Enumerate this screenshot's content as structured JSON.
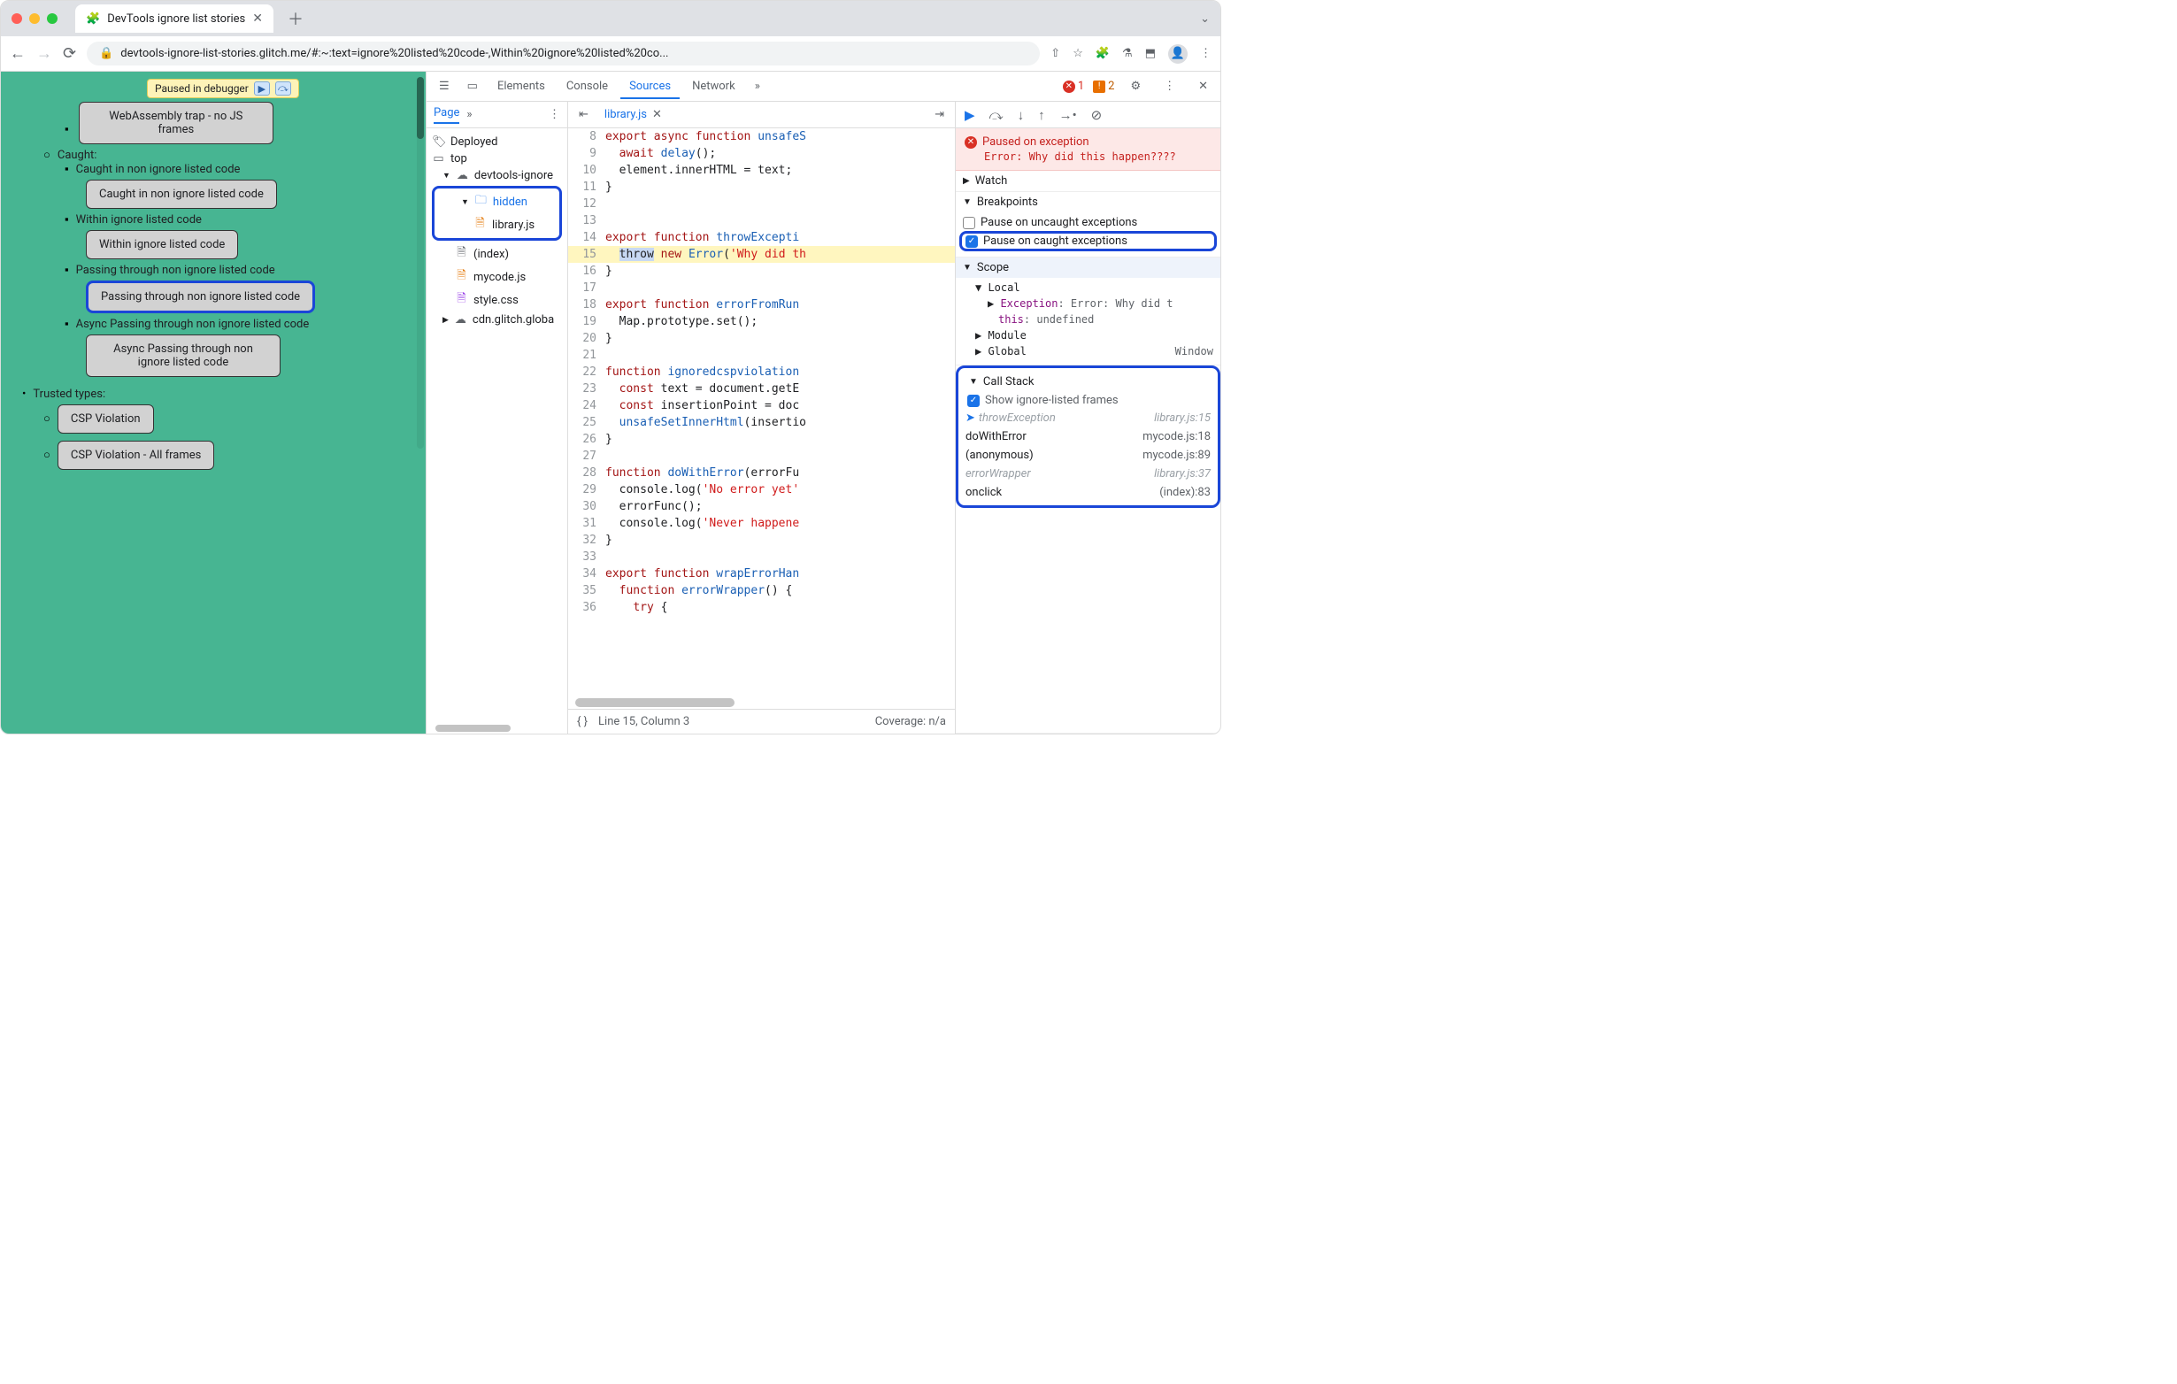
{
  "tab": {
    "title": "DevTools ignore list stories"
  },
  "address": {
    "url": "devtools-ignore-list-stories.glitch.me/#:~:text=ignore%20listed%20code-,Within%20ignore%20listed%20co..."
  },
  "pausedPill": {
    "text": "Paused in debugger"
  },
  "page": {
    "item0": "WebAssembly trap - no JS frames",
    "caught": "Caught:",
    "caught_item1": "Caught in non ignore listed code",
    "caught_btn1": "Caught in non ignore listed code",
    "caught_item2": "Within ignore listed code",
    "caught_btn2": "Within ignore listed code",
    "caught_item3": "Passing through non ignore listed code",
    "caught_btn3": "Passing through non ignore listed code",
    "caught_item4": "Async Passing through non ignore listed code",
    "caught_btn4": "Async Passing through non ignore listed code",
    "trusted": "Trusted types:",
    "trusted_btn1": "CSP Violation",
    "trusted_btn2": "CSP Violation - All frames"
  },
  "devtools": {
    "tabs": {
      "elements": "Elements",
      "console": "Console",
      "sources": "Sources",
      "network": "Network"
    },
    "errCount": "1",
    "warnCount": "2",
    "navigator": {
      "page": "Page",
      "deployed": "Deployed",
      "top": "top",
      "origin": "devtools-ignore",
      "hidden": "hidden",
      "library": "library.js",
      "index": "(index)",
      "mycode": "mycode.js",
      "style": "style.css",
      "cdn": "cdn.glitch.globa"
    },
    "editor": {
      "file": "library.js",
      "lines": {
        "8": "export async function unsafeS",
        "9": "  await delay();",
        "10": "  element.innerHTML = text;",
        "11": "}",
        "12": "",
        "13": "",
        "14": "export function throwExcepti",
        "15": "  throw new Error('Why did th",
        "16": "}",
        "17": "",
        "18": "export function errorFromRun",
        "19": "  Map.prototype.set();",
        "20": "}",
        "21": "",
        "22": "function ignoredcspviolation",
        "23": "  const text = document.getE",
        "24": "  const insertionPoint = doc",
        "25": "  unsafeSetInnerHtml(insertio",
        "26": "}",
        "27": "",
        "28": "function doWithError(errorFu",
        "29": "  console.log('No error yet'",
        "30": "  errorFunc();",
        "31": "  console.log('Never happene",
        "32": "}",
        "33": "",
        "34": "export function wrapErrorHan",
        "35": "  function errorWrapper() {",
        "36": "    try {"
      },
      "status": {
        "pos": "Line 15, Column 3",
        "cov": "Coverage: n/a"
      }
    },
    "debug": {
      "paused": {
        "title": "Paused on exception",
        "detail": "Error: Why did this happen????"
      },
      "watch": "Watch",
      "breakpoints": "Breakpoints",
      "bp1": "Pause on uncaught exceptions",
      "bp2": "Pause on caught exceptions",
      "scope": "Scope",
      "local": "Local",
      "exceptionKey": "Exception",
      "exceptionVal": ": Error: Why did t",
      "thisKey": "this",
      "thisVal": ": undefined",
      "module": "Module",
      "global": "Global",
      "globalVal": "Window",
      "callstack": "Call Stack",
      "showIgnore": "Show ignore-listed frames",
      "frames": [
        {
          "name": "throwException",
          "loc": "library.js:15",
          "dim": true,
          "current": true
        },
        {
          "name": "doWithError",
          "loc": "mycode.js:18"
        },
        {
          "name": "(anonymous)",
          "loc": "mycode.js:89"
        },
        {
          "name": "errorWrapper",
          "loc": "library.js:37",
          "dim": true
        },
        {
          "name": "onclick",
          "loc": "(index):83"
        }
      ]
    }
  }
}
